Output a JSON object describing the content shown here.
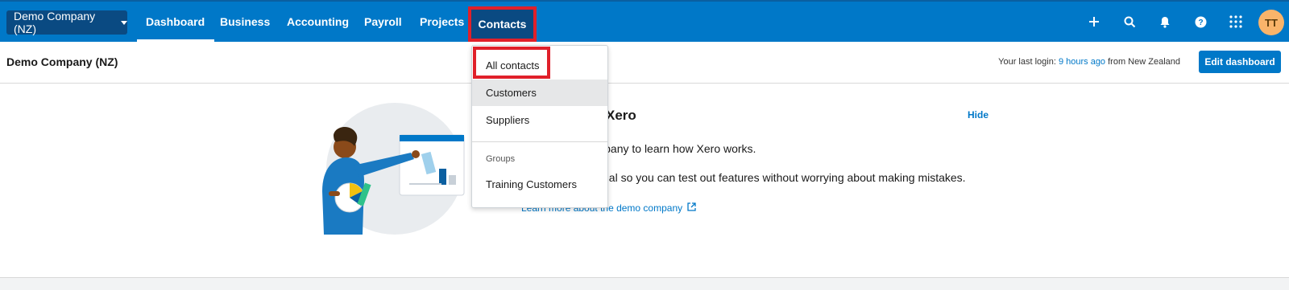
{
  "org": {
    "name": "Demo Company (NZ)"
  },
  "nav": {
    "items": [
      "Dashboard",
      "Business",
      "Accounting",
      "Payroll",
      "Projects",
      "Contacts"
    ],
    "active": "Dashboard",
    "open": "Contacts"
  },
  "top_icons": [
    "plus-icon",
    "search-icon",
    "bell-icon",
    "help-icon",
    "apps-grid-icon"
  ],
  "user": {
    "initials": "TT"
  },
  "subheader": {
    "title": "Demo Company (NZ)",
    "last_login_prefix": "Your last login:",
    "last_login_time": "9 hours ago",
    "last_login_suffix": "from New Zealand",
    "edit_dashboard": "Edit dashboard"
  },
  "welcome": {
    "title": "Xero",
    "hide": "Hide",
    "line1": "o company to learn how Xero works.",
    "line2": "nal so you can test out features without worrying about making mistakes.",
    "learn_more": "Learn more about the demo company"
  },
  "contacts_menu": {
    "items": [
      "All contacts",
      "Customers",
      "Suppliers"
    ],
    "group_label": "Groups",
    "groups": [
      "Training Customers"
    ],
    "hovered": "Customers",
    "highlighted": "All contacts"
  },
  "colors": {
    "brand_blue": "#0078c8",
    "nav_dark": "#0a4a82",
    "highlight_red": "#e0202a",
    "avatar": "#f9b46a"
  }
}
